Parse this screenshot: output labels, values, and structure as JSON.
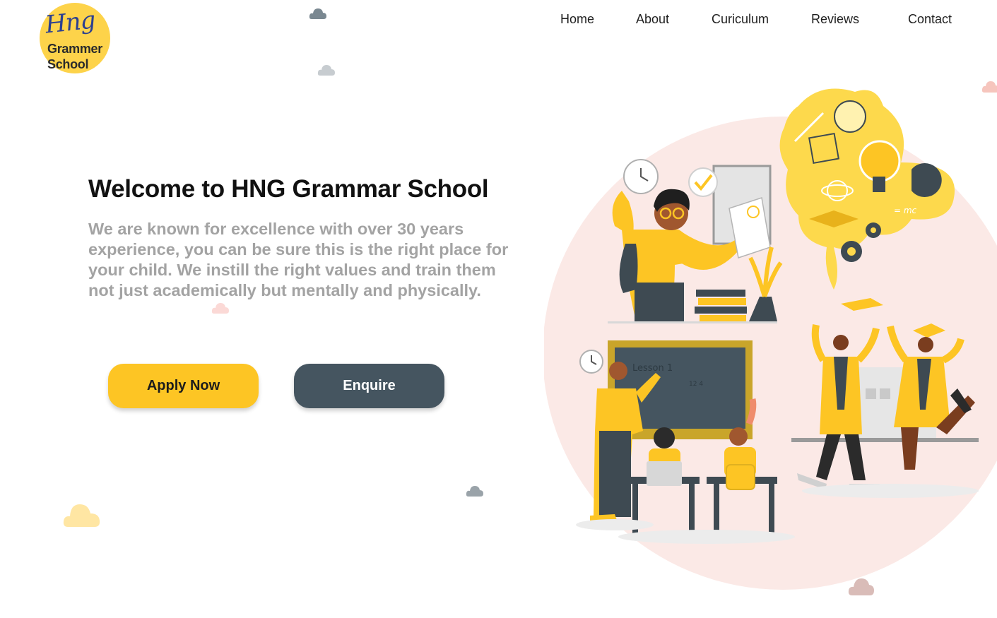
{
  "logo": {
    "script_text": "Hng",
    "line1": "Grammer",
    "line2": "School"
  },
  "nav": {
    "items": [
      "Home",
      "About",
      "Curiculum",
      "Reviews",
      "Contact"
    ]
  },
  "hero": {
    "title": "Welcome to HNG Grammar School",
    "description": "We are known for excellence with over 30 years experience, you can be sure this is the right place for your child. We instill the right values and train them not just academically but mentally and physically.",
    "apply_label": "Apply Now",
    "enquire_label": "Enquire"
  },
  "illustration": {
    "chalkboard_text": "Lesson 1",
    "chalkboard_numbers": "12   4",
    "formula": "= mc"
  },
  "colors": {
    "accent": "#fdc524",
    "dark": "#455560",
    "logo_bg": "#fdd34a",
    "logo_script": "#2b3f91",
    "illustration_bg": "#fbe9e6",
    "text_muted": "#a3a3a3"
  }
}
